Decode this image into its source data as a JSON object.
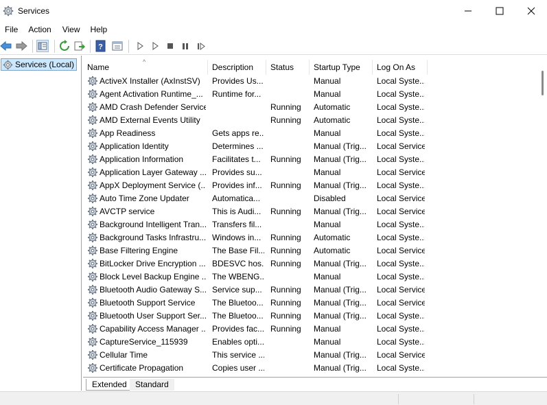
{
  "window": {
    "title": "Services",
    "app_icon": "gear-icon"
  },
  "window_controls": [
    "minimize-icon",
    "maximize-icon",
    "close-icon"
  ],
  "menu": [
    {
      "label": "File"
    },
    {
      "label": "Action"
    },
    {
      "label": "View"
    },
    {
      "label": "Help"
    }
  ],
  "toolbar": {
    "buttons": [
      "back-arrow-icon",
      "forward-arrow-icon",
      "show-hide-console-tree-icon",
      "refresh-icon",
      "export-list-icon",
      "help-icon",
      "properties-icon",
      "start-service-icon",
      "start-service-alt-icon",
      "stop-service-icon",
      "pause-service-icon",
      "resume-service-icon"
    ]
  },
  "tree": {
    "selected_node": "Services (Local)"
  },
  "columns": {
    "name": "Name",
    "description": "Description",
    "status": "Status",
    "startup_type": "Startup Type",
    "log_on_as": "Log On As",
    "sort_indicator": "^"
  },
  "services": [
    {
      "name": "ActiveX Installer (AxInstSV)",
      "description": "Provides Us...",
      "status": "",
      "startup": "Manual",
      "logon": "Local Syste..."
    },
    {
      "name": "Agent Activation Runtime_...",
      "description": "Runtime for...",
      "status": "",
      "startup": "Manual",
      "logon": "Local Syste..."
    },
    {
      "name": "AMD Crash Defender Service",
      "description": "",
      "status": "Running",
      "startup": "Automatic",
      "logon": "Local Syste..."
    },
    {
      "name": "AMD External Events Utility",
      "description": "",
      "status": "Running",
      "startup": "Automatic",
      "logon": "Local Syste..."
    },
    {
      "name": "App Readiness",
      "description": "Gets apps re...",
      "status": "",
      "startup": "Manual",
      "logon": "Local Syste..."
    },
    {
      "name": "Application Identity",
      "description": "Determines ...",
      "status": "",
      "startup": "Manual (Trig...",
      "logon": "Local Service"
    },
    {
      "name": "Application Information",
      "description": "Facilitates t...",
      "status": "Running",
      "startup": "Manual (Trig...",
      "logon": "Local Syste..."
    },
    {
      "name": "Application Layer Gateway ...",
      "description": "Provides su...",
      "status": "",
      "startup": "Manual",
      "logon": "Local Service"
    },
    {
      "name": "AppX Deployment Service (...",
      "description": "Provides inf...",
      "status": "Running",
      "startup": "Manual (Trig...",
      "logon": "Local Syste..."
    },
    {
      "name": "Auto Time Zone Updater",
      "description": "Automatica...",
      "status": "",
      "startup": "Disabled",
      "logon": "Local Service"
    },
    {
      "name": "AVCTP service",
      "description": "This is Audi...",
      "status": "Running",
      "startup": "Manual (Trig...",
      "logon": "Local Service"
    },
    {
      "name": "Background Intelligent Tran...",
      "description": "Transfers fil...",
      "status": "",
      "startup": "Manual",
      "logon": "Local Syste..."
    },
    {
      "name": "Background Tasks Infrastru...",
      "description": "Windows in...",
      "status": "Running",
      "startup": "Automatic",
      "logon": "Local Syste..."
    },
    {
      "name": "Base Filtering Engine",
      "description": "The Base Fil...",
      "status": "Running",
      "startup": "Automatic",
      "logon": "Local Service"
    },
    {
      "name": "BitLocker Drive Encryption ...",
      "description": "BDESVC hos...",
      "status": "Running",
      "startup": "Manual (Trig...",
      "logon": "Local Syste..."
    },
    {
      "name": "Block Level Backup Engine ...",
      "description": "The WBENG...",
      "status": "",
      "startup": "Manual",
      "logon": "Local Syste..."
    },
    {
      "name": "Bluetooth Audio Gateway S...",
      "description": "Service sup...",
      "status": "Running",
      "startup": "Manual (Trig...",
      "logon": "Local Service"
    },
    {
      "name": "Bluetooth Support Service",
      "description": "The Bluetoo...",
      "status": "Running",
      "startup": "Manual (Trig...",
      "logon": "Local Service"
    },
    {
      "name": "Bluetooth User Support Ser...",
      "description": "The Bluetoo...",
      "status": "Running",
      "startup": "Manual (Trig...",
      "logon": "Local Syste..."
    },
    {
      "name": "Capability Access Manager ...",
      "description": "Provides fac...",
      "status": "Running",
      "startup": "Manual",
      "logon": "Local Syste..."
    },
    {
      "name": "CaptureService_115939",
      "description": "Enables opti...",
      "status": "",
      "startup": "Manual",
      "logon": "Local Syste..."
    },
    {
      "name": "Cellular Time",
      "description": "This service ...",
      "status": "",
      "startup": "Manual (Trig...",
      "logon": "Local Service"
    },
    {
      "name": "Certificate Propagation",
      "description": "Copies user ...",
      "status": "",
      "startup": "Manual (Trig...",
      "logon": "Local Syste..."
    }
  ],
  "tabs": [
    {
      "label": "Extended",
      "active": true
    },
    {
      "label": "Standard",
      "active": false
    }
  ],
  "colors": {
    "selection": "#cce8ff",
    "selection_border": "#7da2ce",
    "status_bar": "#f0f0f0"
  }
}
